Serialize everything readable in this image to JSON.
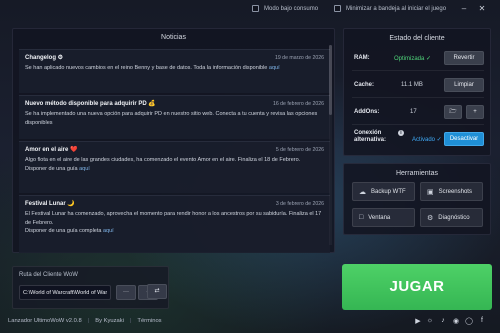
{
  "topbar": {
    "low_consumption": "Modo bajo consumo",
    "minimize_tray": "Minimizar a bandeja al iniciar el juego"
  },
  "news": {
    "title": "Noticias",
    "items": [
      {
        "title": "Changelog ⚙",
        "date": "19 de marzo de 2026",
        "body": "Se han aplicado nuevos cambios en el reino Benny y base de datos. Toda la información disponible",
        "link": "aquí"
      },
      {
        "title": "Nuevo método disponible para adquirir PD 💰",
        "date": "16 de febrero de 2026",
        "body": "Se ha implementado una nueva opción para adquirir PD en nuestro sitio web. Conecta a tu cuenta y revisa las opciones disponibles",
        "link": ""
      },
      {
        "title": "Amor en el aire ❤️",
        "date": "5 de febrero de 2026",
        "body": "Algo flota en el aire de las grandes ciudades, ha comenzado el evento Amor en el aire. Finaliza el 18 de Febrero.",
        "body2": "Disponer de una guía",
        "link": "aquí"
      },
      {
        "title": "Festival Lunar 🌙",
        "date": "3 de febrero de 2026",
        "body": "El Festival Lunar ha comenzado, aprovecha el momento para rendir honor a los ancestros por su sabiduría. Finaliza el 17 de Febrero.",
        "body2": "Disponer de una guía completa",
        "link": "aquí"
      }
    ]
  },
  "status": {
    "title": "Estado del cliente",
    "ram_label": "RAM:",
    "ram_value": "Optimizada ✓",
    "ram_button": "Revertir",
    "cache_label": "Cache:",
    "cache_value": "11.1 MB",
    "cache_button": "Limpiar",
    "addons_label": "AddOns:",
    "addons_value": "17",
    "conn_label_1": "Conexión",
    "conn_label_2": "alternativa:",
    "conn_value": "Activado ✓",
    "conn_button": "Desactivar"
  },
  "tools": {
    "title": "Herramientas",
    "backup": "Backup WTF",
    "screenshots": "Screenshots",
    "window": "Ventana",
    "diagnostic": "Diagnóstico"
  },
  "path": {
    "label": "Ruta del Cliente WoW",
    "value": "C:\\World of Warcraft\\World of Warcraft"
  },
  "play": {
    "label": "JUGAR"
  },
  "footer": {
    "app": "Lanzador UltimoWoW v2.0.8",
    "by": "By Kyuzaki",
    "terms": "Términos"
  },
  "colors": {
    "accent_green": "#4fd37a",
    "play_green": "#3cc25c",
    "button_blue": "#1f8fd6"
  }
}
